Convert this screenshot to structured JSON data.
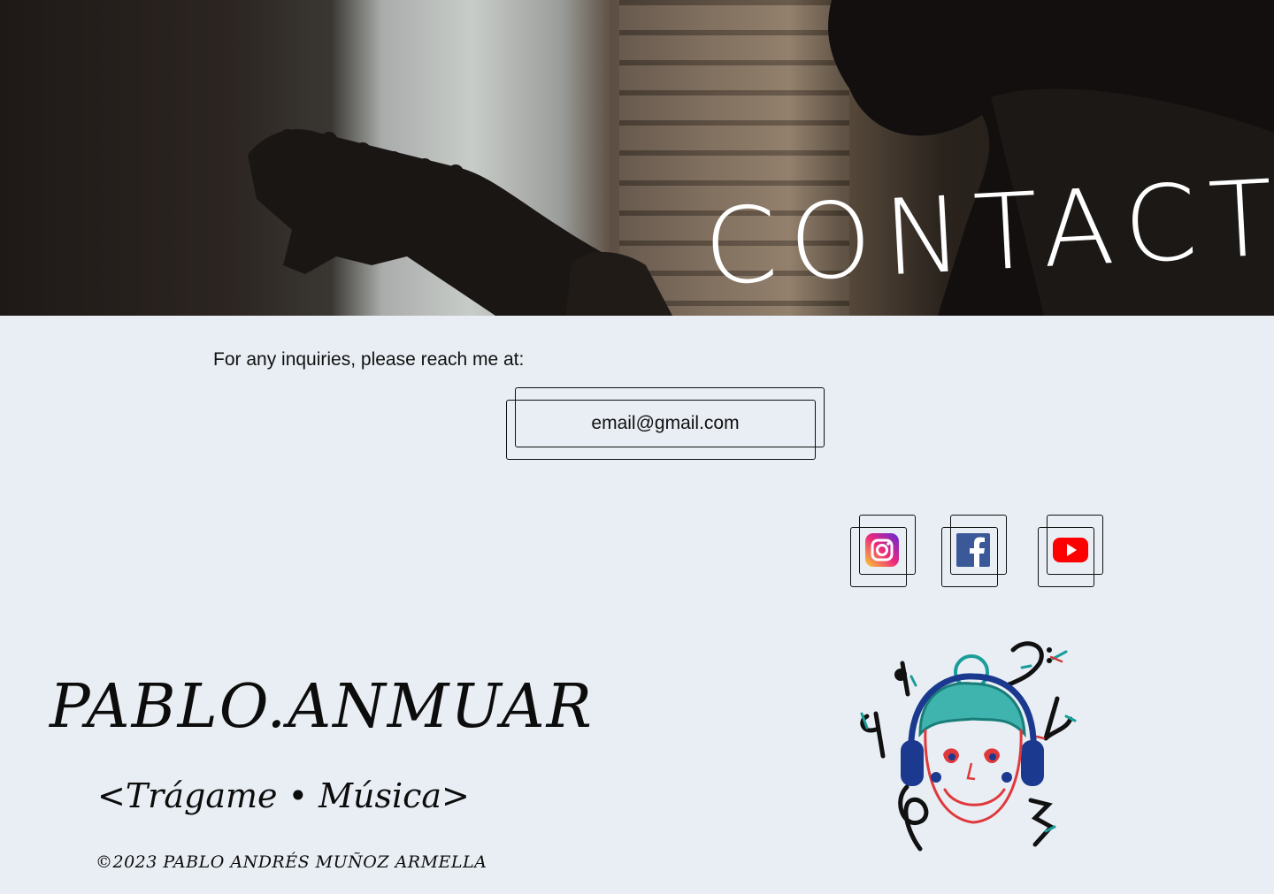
{
  "hero": {
    "title": "CONTACT"
  },
  "contact": {
    "inquiry_text": "For any inquiries, please reach me at:",
    "email_label": "email@gmail.com"
  },
  "social": [
    {
      "name": "Instagram",
      "icon": "instagram-icon"
    },
    {
      "name": "Facebook",
      "icon": "facebook-icon"
    },
    {
      "name": "YouTube",
      "icon": "youtube-icon"
    }
  ],
  "footer": {
    "brand": "PABLO.ANMUAR",
    "tagline": "<Trágame • Música>",
    "copyright": "©2023 PABLO ANDRÉS MUÑOZ ARMELLA"
  },
  "colors": {
    "background": "#e8eef4",
    "text": "#111111",
    "hero_title": "#ffffff",
    "instagram_gradient": [
      "#f9ce34",
      "#ee2a7b",
      "#6228d7"
    ],
    "facebook": "#3b5998",
    "youtube": "#ff0000"
  }
}
